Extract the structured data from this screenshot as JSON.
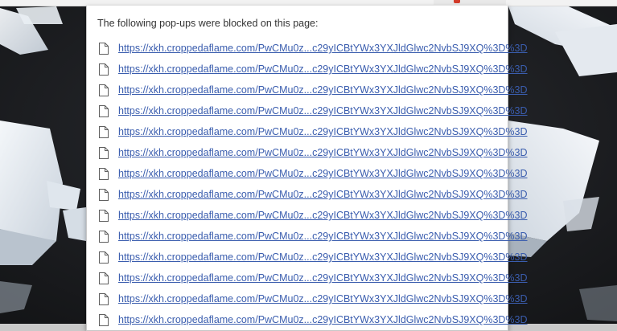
{
  "popup": {
    "title": "The following pop-ups were blocked on this page:",
    "item_icon": "page-icon",
    "link_color": "#3a5dae",
    "items": [
      {
        "url": "https://xkh.croppedaflame.com/PwCMu0z...c29yICBtYWx3YXJldGlwc2NvbSJ9XQ%3D%3D"
      },
      {
        "url": "https://xkh.croppedaflame.com/PwCMu0z...c29yICBtYWx3YXJldGlwc2NvbSJ9XQ%3D%3D"
      },
      {
        "url": "https://xkh.croppedaflame.com/PwCMu0z...c29yICBtYWx3YXJldGlwc2NvbSJ9XQ%3D%3D"
      },
      {
        "url": "https://xkh.croppedaflame.com/PwCMu0z...c29yICBtYWx3YXJldGlwc2NvbSJ9XQ%3D%3D"
      },
      {
        "url": "https://xkh.croppedaflame.com/PwCMu0z...c29yICBtYWx3YXJldGlwc2NvbSJ9XQ%3D%3D"
      },
      {
        "url": "https://xkh.croppedaflame.com/PwCMu0z...c29yICBtYWx3YXJldGlwc2NvbSJ9XQ%3D%3D"
      },
      {
        "url": "https://xkh.croppedaflame.com/PwCMu0z...c29yICBtYWx3YXJldGlwc2NvbSJ9XQ%3D%3D"
      },
      {
        "url": "https://xkh.croppedaflame.com/PwCMu0z...c29yICBtYWx3YXJldGlwc2NvbSJ9XQ%3D%3D"
      },
      {
        "url": "https://xkh.croppedaflame.com/PwCMu0z...c29yICBtYWx3YXJldGlwc2NvbSJ9XQ%3D%3D"
      },
      {
        "url": "https://xkh.croppedaflame.com/PwCMu0z...c29yICBtYWx3YXJldGlwc2NvbSJ9XQ%3D%3D"
      },
      {
        "url": "https://xkh.croppedaflame.com/PwCMu0z...c29yICBtYWx3YXJldGlwc2NvbSJ9XQ%3D%3D"
      },
      {
        "url": "https://xkh.croppedaflame.com/PwCMu0z...c29yICBtYWx3YXJldGlwc2NvbSJ9XQ%3D%3D"
      },
      {
        "url": "https://xkh.croppedaflame.com/PwCMu0z...c29yICBtYWx3YXJldGlwc2NvbSJ9XQ%3D%3D"
      },
      {
        "url": "https://xkh.croppedaflame.com/PwCMu0z...c29yICBtYWx3YXJldGlwc2NvbSJ9XQ%3D%3D"
      }
    ]
  },
  "background": {
    "description_colors": {
      "dark": "#1a1b1e",
      "paper": "#e8edf2"
    }
  }
}
